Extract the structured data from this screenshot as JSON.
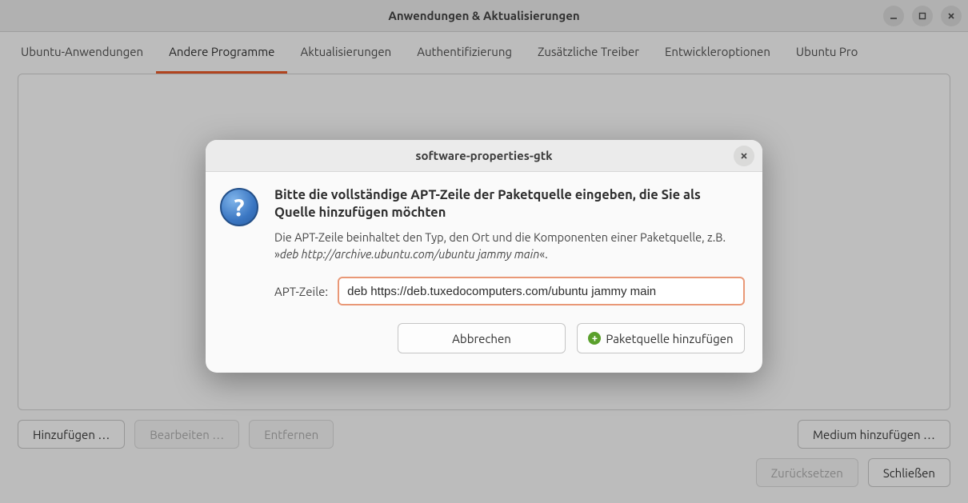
{
  "window": {
    "title": "Anwendungen & Aktualisierungen"
  },
  "tabs": [
    {
      "label": "Ubuntu-Anwendungen",
      "active": false
    },
    {
      "label": "Andere Programme",
      "active": true
    },
    {
      "label": "Aktualisierungen",
      "active": false
    },
    {
      "label": "Authentifizierung",
      "active": false
    },
    {
      "label": "Zusätzliche Treiber",
      "active": false
    },
    {
      "label": "Entwickleroptionen",
      "active": false
    },
    {
      "label": "Ubuntu Pro",
      "active": false
    }
  ],
  "buttons": {
    "add": "Hinzufügen …",
    "edit": "Bearbeiten …",
    "remove": "Entfernen",
    "add_medium": "Medium hinzufügen …",
    "reset": "Zurücksetzen",
    "close": "Schließen"
  },
  "modal": {
    "title": "software-properties-gtk",
    "heading": "Bitte die vollständige APT-Zeile der Paketquelle eingeben, die Sie als Quelle hinzufügen möchten",
    "desc_pre": "Die APT-Zeile beinhaltet den Typ, den Ort und die Komponenten einer Paketquelle, z.B. »",
    "example": "deb http://archive.ubuntu.com/ubuntu jammy main",
    "desc_post": "«.",
    "input_label": "APT-Zeile:",
    "input_value": "deb https://deb.tuxedocomputers.com/ubuntu jammy main",
    "cancel": "Abbrechen",
    "add_source": "Paketquelle hinzufügen"
  }
}
